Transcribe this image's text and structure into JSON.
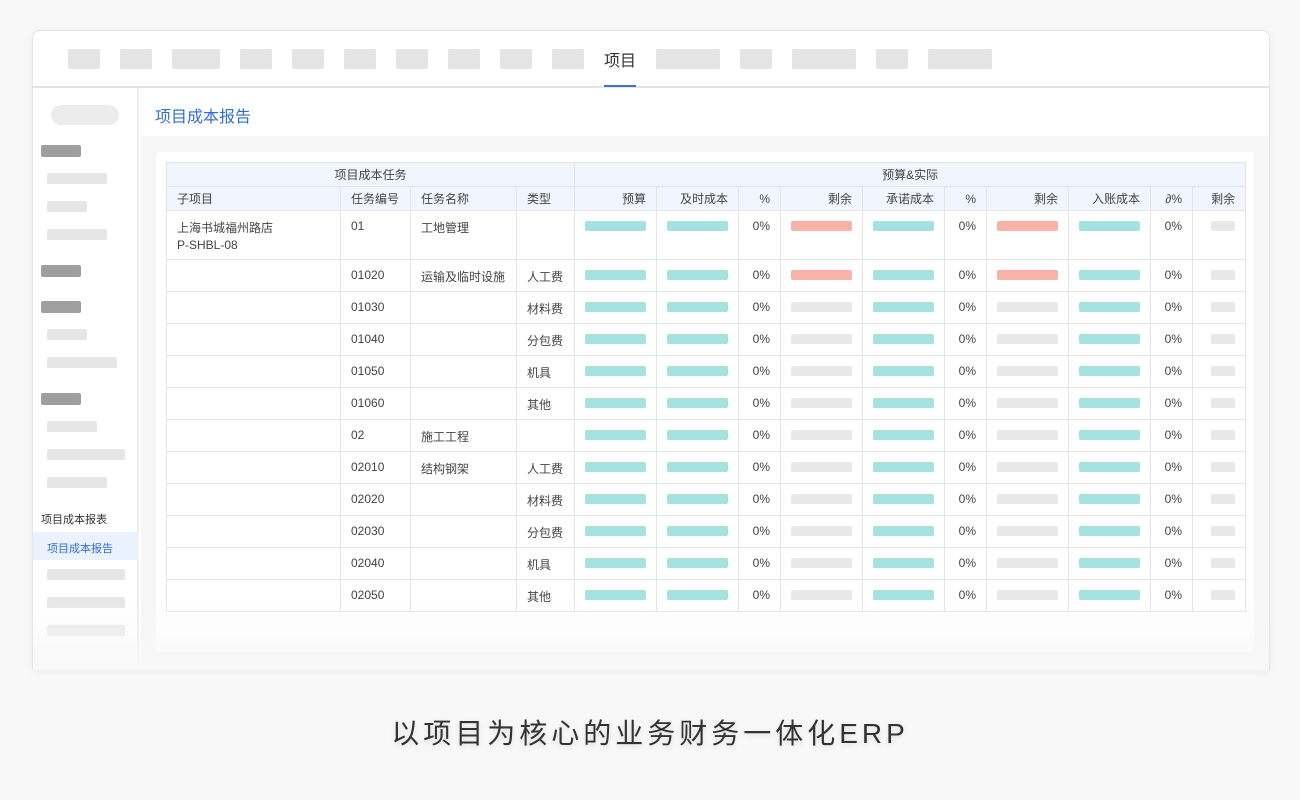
{
  "nav": {
    "active_tab": "项目"
  },
  "sidebar": {
    "group_label": "项目成本报表",
    "active_item": "项目成本报告"
  },
  "page": {
    "title": "项目成本报告"
  },
  "table": {
    "group_headers": [
      "项目成本任务",
      "预算&实际"
    ],
    "columns": [
      "子项目",
      "任务编号",
      "任务名称",
      "类型",
      "预算",
      "及时成本",
      "%",
      "剩余",
      "承诺成本",
      "%",
      "剩余",
      "入账成本",
      "∂%",
      "剩余"
    ],
    "rows": [
      {
        "sub": "上海书城福州路店",
        "sub2": "P-SHBL-08",
        "code": "01",
        "name": "工地管理",
        "type": "",
        "p1": "0%",
        "p2": "0%",
        "p3": "0%",
        "r1": "red",
        "r2": "red"
      },
      {
        "sub": "",
        "sub2": "",
        "code": "01020",
        "name": "运输及临时设施",
        "type": "人工费",
        "p1": "0%",
        "p2": "0%",
        "p3": "0%",
        "r1": "red",
        "r2": "red"
      },
      {
        "sub": "",
        "sub2": "",
        "code": "01030",
        "name": "",
        "type": "材料费",
        "p1": "0%",
        "p2": "0%",
        "p3": "0%",
        "r1": "gray",
        "r2": "gray"
      },
      {
        "sub": "",
        "sub2": "",
        "code": "01040",
        "name": "",
        "type": "分包费",
        "p1": "0%",
        "p2": "0%",
        "p3": "0%",
        "r1": "gray",
        "r2": "gray"
      },
      {
        "sub": "",
        "sub2": "",
        "code": "01050",
        "name": "",
        "type": "机具",
        "p1": "0%",
        "p2": "0%",
        "p3": "0%",
        "r1": "gray",
        "r2": "gray"
      },
      {
        "sub": "",
        "sub2": "",
        "code": "01060",
        "name": "",
        "type": "其他",
        "p1": "0%",
        "p2": "0%",
        "p3": "0%",
        "r1": "gray",
        "r2": "gray"
      },
      {
        "sub": "",
        "sub2": "",
        "code": "02",
        "name": "施工工程",
        "type": "",
        "p1": "0%",
        "p2": "0%",
        "p3": "0%",
        "r1": "gray",
        "r2": "gray"
      },
      {
        "sub": "",
        "sub2": "",
        "code": "02010",
        "name": "结构钢架",
        "type": "人工费",
        "p1": "0%",
        "p2": "0%",
        "p3": "0%",
        "r1": "gray",
        "r2": "gray"
      },
      {
        "sub": "",
        "sub2": "",
        "code": "02020",
        "name": "",
        "type": "材料费",
        "p1": "0%",
        "p2": "0%",
        "p3": "0%",
        "r1": "gray",
        "r2": "gray"
      },
      {
        "sub": "",
        "sub2": "",
        "code": "02030",
        "name": "",
        "type": "分包费",
        "p1": "0%",
        "p2": "0%",
        "p3": "0%",
        "r1": "gray",
        "r2": "gray"
      },
      {
        "sub": "",
        "sub2": "",
        "code": "02040",
        "name": "",
        "type": "机具",
        "p1": "0%",
        "p2": "0%",
        "p3": "0%",
        "r1": "gray",
        "r2": "gray"
      },
      {
        "sub": "",
        "sub2": "",
        "code": "02050",
        "name": "",
        "type": "其他",
        "p1": "0%",
        "p2": "0%",
        "p3": "0%",
        "r1": "gray",
        "r2": "gray"
      }
    ]
  },
  "tagline": "以项目为核心的业务财务一体化ERP",
  "colors": {
    "accent": "#2f6fd8",
    "bar_teal": "#a3e2df",
    "bar_red": "#f9b2a8",
    "bar_gray": "#e8e8e8"
  }
}
